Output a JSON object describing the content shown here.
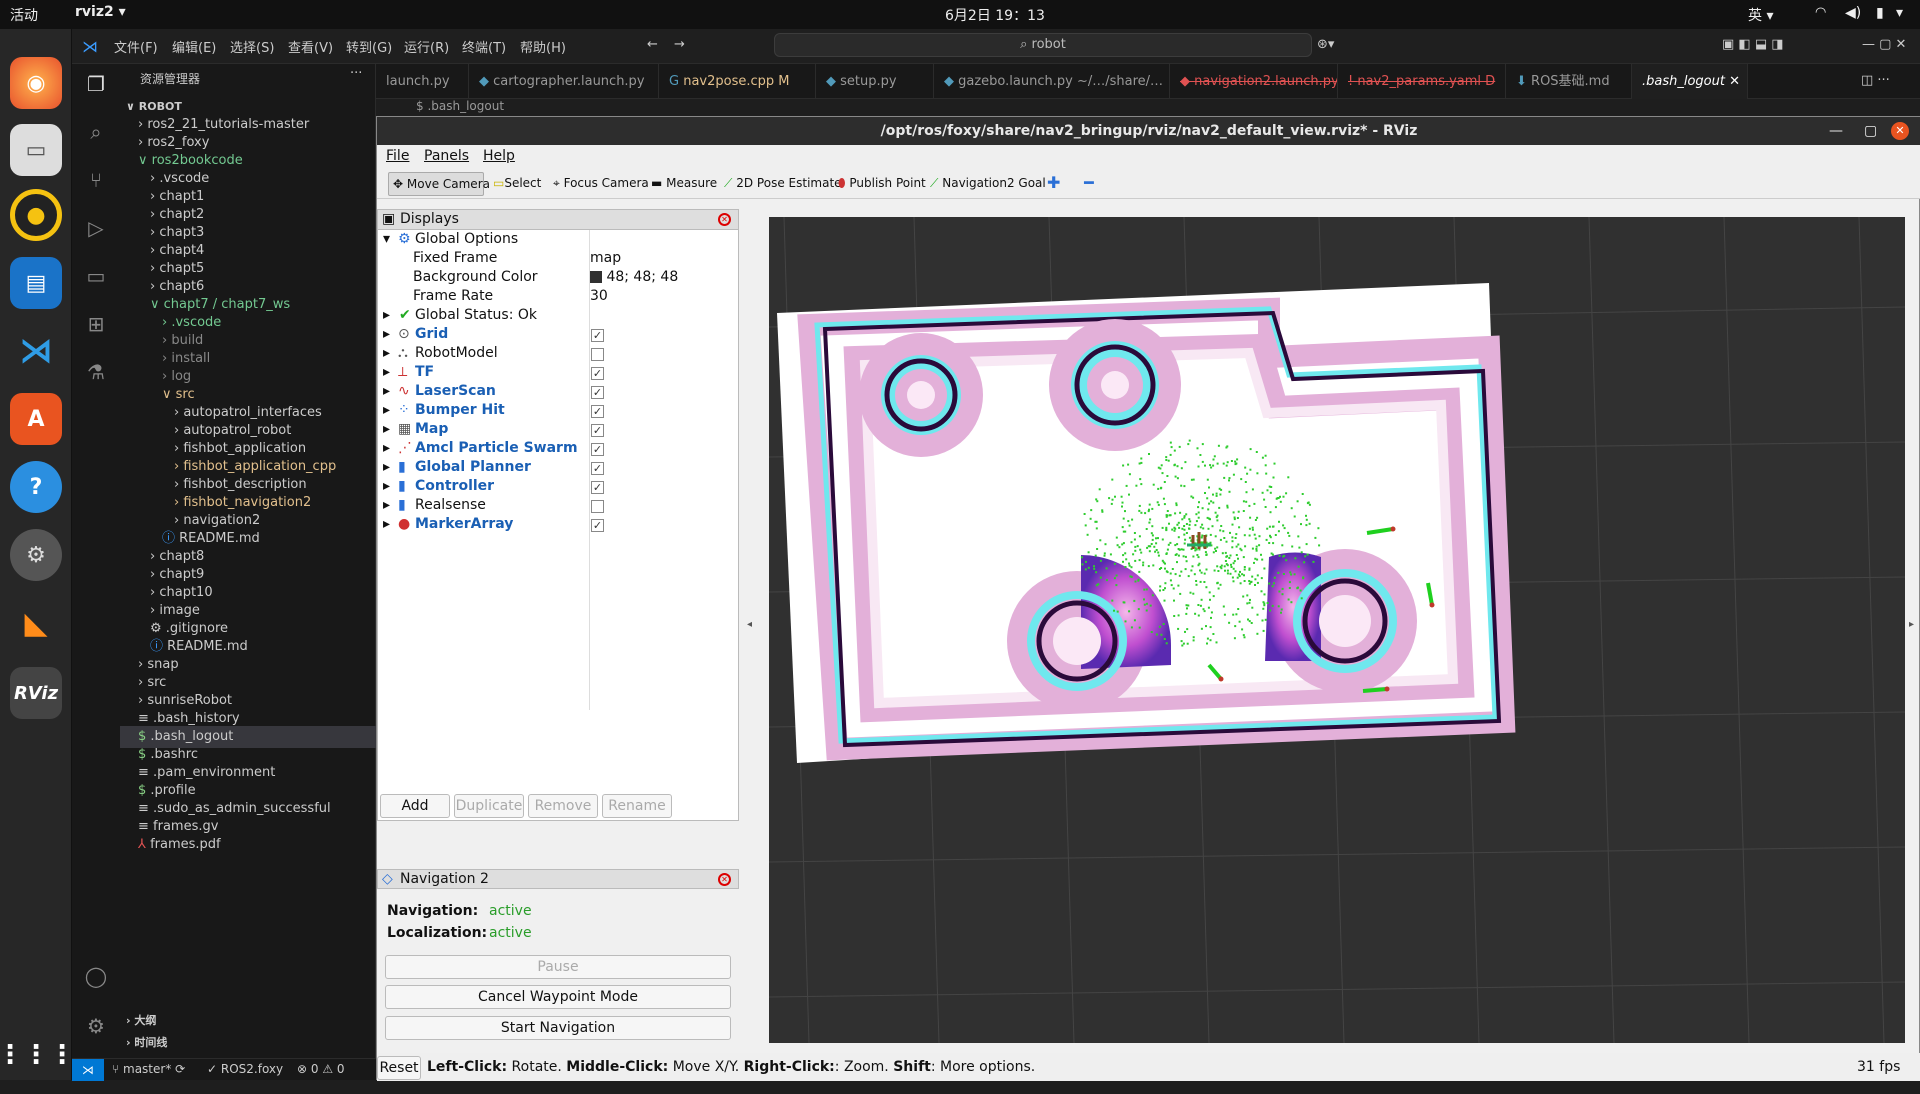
{
  "topbar": {
    "activities": "活动",
    "app": "rviz2 ▾",
    "clock": "6月2日  19：13",
    "ime": "英 ▾"
  },
  "dock": {
    "items": [
      "firefox-icon",
      "files-icon",
      "rhythmbox-icon",
      "writer-icon",
      "vscode-icon",
      "software-icon",
      "help-icon",
      "settings-icon",
      "sublime-icon",
      "rviz-icon"
    ],
    "rviz_label": "RViz"
  },
  "vscode": {
    "menus": [
      "文件(F)",
      "编辑(E)",
      "选择(S)",
      "查看(V)",
      "转到(G)",
      "运行(R)",
      "终端(T)",
      "帮助(H)"
    ],
    "search": "robot",
    "explorer_title": "资源管理器",
    "root": "ROBOT",
    "tree": [
      {
        "label": "ros2_21_tutorials-master",
        "indent": 0,
        "kind": "folder"
      },
      {
        "label": "ros2_foxy",
        "indent": 0,
        "kind": "folder"
      },
      {
        "label": "ros2bookcode",
        "indent": 0,
        "kind": "open",
        "cls": "git"
      },
      {
        "label": ".vscode",
        "indent": 1,
        "kind": "folder"
      },
      {
        "label": "chapt1",
        "indent": 1,
        "kind": "folder"
      },
      {
        "label": "chapt2",
        "indent": 1,
        "kind": "folder"
      },
      {
        "label": "chapt3",
        "indent": 1,
        "kind": "folder"
      },
      {
        "label": "chapt4",
        "indent": 1,
        "kind": "folder"
      },
      {
        "label": "chapt5",
        "indent": 1,
        "kind": "folder"
      },
      {
        "label": "chapt6",
        "indent": 1,
        "kind": "folder"
      },
      {
        "label": "chapt7 / chapt7_ws",
        "indent": 1,
        "kind": "open",
        "cls": "git"
      },
      {
        "label": ".vscode",
        "indent": 2,
        "kind": "folder",
        "cls": "git"
      },
      {
        "label": "build",
        "indent": 2,
        "kind": "folder",
        "cls": "dim"
      },
      {
        "label": "install",
        "indent": 2,
        "kind": "folder",
        "cls": "dim"
      },
      {
        "label": "log",
        "indent": 2,
        "kind": "folder",
        "cls": "dim"
      },
      {
        "label": "src",
        "indent": 2,
        "kind": "open",
        "cls": "mod"
      },
      {
        "label": "autopatrol_interfaces",
        "indent": 3,
        "kind": "folder"
      },
      {
        "label": "autopatrol_robot",
        "indent": 3,
        "kind": "folder"
      },
      {
        "label": "fishbot_application",
        "indent": 3,
        "kind": "folder"
      },
      {
        "label": "fishbot_application_cpp",
        "indent": 3,
        "kind": "folder",
        "cls": "mod"
      },
      {
        "label": "fishbot_description",
        "indent": 3,
        "kind": "folder"
      },
      {
        "label": "fishbot_navigation2",
        "indent": 3,
        "kind": "folder",
        "cls": "mod"
      },
      {
        "label": "navigation2",
        "indent": 3,
        "kind": "folder"
      },
      {
        "label": "README.md",
        "indent": 2,
        "kind": "info"
      },
      {
        "label": "chapt8",
        "indent": 1,
        "kind": "folder"
      },
      {
        "label": "chapt9",
        "indent": 1,
        "kind": "folder"
      },
      {
        "label": "chapt10",
        "indent": 1,
        "kind": "folder"
      },
      {
        "label": "image",
        "indent": 1,
        "kind": "folder"
      },
      {
        "label": ".gitignore",
        "indent": 1,
        "kind": "gear"
      },
      {
        "label": "README.md",
        "indent": 1,
        "kind": "info"
      },
      {
        "label": "snap",
        "indent": 0,
        "kind": "folder"
      },
      {
        "label": "src",
        "indent": 0,
        "kind": "folder"
      },
      {
        "label": "sunriseRobot",
        "indent": 0,
        "kind": "folder"
      },
      {
        "label": ".bash_history",
        "indent": 0,
        "kind": "file"
      },
      {
        "label": ".bash_logout",
        "indent": 0,
        "kind": "dollar",
        "sel": true
      },
      {
        "label": ".bashrc",
        "indent": 0,
        "kind": "dollar"
      },
      {
        "label": ".pam_environment",
        "indent": 0,
        "kind": "file"
      },
      {
        "label": ".profile",
        "indent": 0,
        "kind": "dollar"
      },
      {
        "label": ".sudo_as_admin_successful",
        "indent": 0,
        "kind": "file"
      },
      {
        "label": "frames.gv",
        "indent": 0,
        "kind": "file"
      },
      {
        "label": "frames.pdf",
        "indent": 0,
        "kind": "pdf"
      }
    ],
    "outline": "大纲",
    "timeline": "时间线",
    "tabs": [
      {
        "label": "launch.py"
      },
      {
        "label": "cartographer.launch.py"
      },
      {
        "label": "nav2pose.cpp  M"
      },
      {
        "label": "setup.py"
      },
      {
        "label": "gazebo.launch.py  ~/…/share/…"
      },
      {
        "label": "navigation2.launch.py  D"
      },
      {
        "label": "nav2_params.yaml  D"
      },
      {
        "label": "ROS基础.md"
      },
      {
        "label": ".bash_logout"
      }
    ],
    "breadcrumb": ".bash_logout",
    "status": {
      "branch": "master*",
      "ros": "ROS2.foxy",
      "problems": "⊗ 0 ⚠ 0"
    }
  },
  "rviz": {
    "title": "/opt/ros/foxy/share/nav2_bringup/rviz/nav2_default_view.rviz* - RViz",
    "menus": [
      "File",
      "Panels",
      "Help"
    ],
    "tools": [
      "Move Camera",
      "Select",
      "Focus Camera",
      "Measure",
      "2D Pose Estimate",
      "Publish Point",
      "Navigation2 Goal"
    ],
    "displays_title": "Displays",
    "global_options": "Global Options",
    "fixed_frame_label": "Fixed Frame",
    "fixed_frame": "map",
    "bg_label": "Background Color",
    "bg_value": "48; 48; 48",
    "fr_label": "Frame Rate",
    "fr_value": "30",
    "status_label": "Global Status: Ok",
    "display_items": [
      {
        "name": "Grid",
        "checked": true,
        "bold": true
      },
      {
        "name": "RobotModel",
        "checked": false,
        "bold": false
      },
      {
        "name": "TF",
        "checked": true,
        "bold": true
      },
      {
        "name": "LaserScan",
        "checked": true,
        "bold": true
      },
      {
        "name": "Bumper Hit",
        "checked": true,
        "bold": true
      },
      {
        "name": "Map",
        "checked": true,
        "bold": true
      },
      {
        "name": "Amcl Particle Swarm",
        "checked": true,
        "bold": true
      },
      {
        "name": "Global Planner",
        "checked": true,
        "bold": true
      },
      {
        "name": "Controller",
        "checked": true,
        "bold": true
      },
      {
        "name": "Realsense",
        "checked": false,
        "bold": false
      },
      {
        "name": "MarkerArray",
        "checked": true,
        "bold": true
      }
    ],
    "buttons": {
      "add": "Add",
      "duplicate": "Duplicate",
      "remove": "Remove",
      "rename": "Rename"
    },
    "nav2": {
      "title": "Navigation 2",
      "nav_label": "Navigation:",
      "nav_value": "active",
      "loc_label": "Localization:",
      "loc_value": "active",
      "pause": "Pause",
      "cancel": "Cancel Waypoint Mode",
      "start": "Start Navigation"
    },
    "reset": "Reset",
    "hint_parts": [
      "Left-Click:",
      " Rotate. ",
      "Middle-Click:",
      " Move X/Y. ",
      "Right-Click:",
      ": Zoom. ",
      "Shift",
      ": More options."
    ],
    "fps": "31 fps"
  }
}
